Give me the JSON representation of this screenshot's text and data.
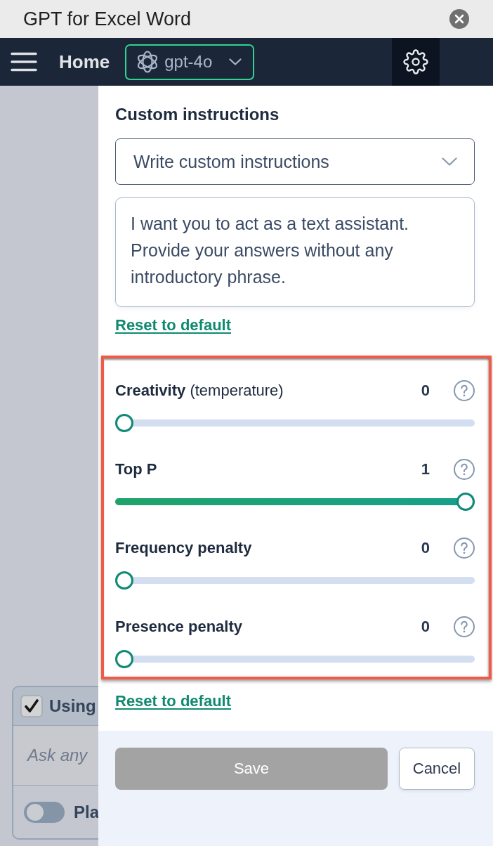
{
  "window": {
    "title": "GPT for Excel Word"
  },
  "navbar": {
    "home": "Home",
    "model": "gpt-4o",
    "settings": {
      "selected": true
    }
  },
  "background": {
    "checkbox": {
      "label": "Using",
      "checked": true
    },
    "message_field": {
      "placeholder": "Ask any"
    },
    "toggle": {
      "label": "Pla",
      "on": false
    }
  },
  "custom_instructions": {
    "heading": "Custom instructions",
    "dropdown": {
      "value": "Write custom instructions"
    },
    "textarea": {
      "value": "I want you to act as a text assistant. Provide your answers without any introductory phrase."
    },
    "reset_link": "Reset to default"
  },
  "parameters": {
    "highlighted": true,
    "sliders": [
      {
        "label": "Creativity",
        "note": "(temperature)",
        "value": "0",
        "level": 0
      },
      {
        "label": "Top P",
        "value": "1",
        "level": 1
      },
      {
        "label": "Frequency penalty",
        "value": "0",
        "level": 0
      },
      {
        "label": "Presence penalty",
        "value": "0",
        "level": 0
      }
    ],
    "reset_link": "Reset to default"
  },
  "footer": {
    "save": {
      "label": "Save",
      "disabled": true
    },
    "cancel": {
      "label": "Cancel"
    }
  }
}
